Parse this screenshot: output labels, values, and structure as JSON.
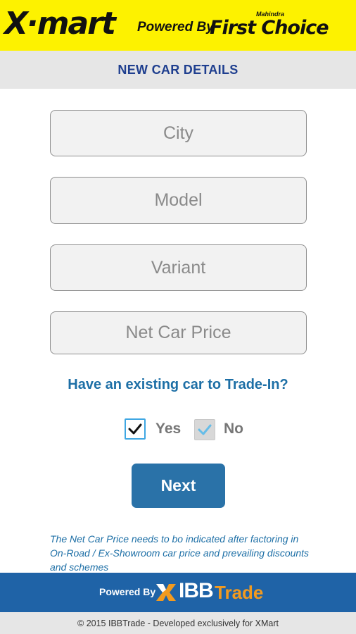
{
  "header": {
    "brand": "X·mart",
    "powered_by": "Powered By",
    "partner_small": "Mahindra",
    "partner": "First Choice",
    "background_color": "#fdf200"
  },
  "page_title": "NEW CAR DETAILS",
  "form": {
    "city_placeholder": "City",
    "model_placeholder": "Model",
    "variant_placeholder": "Variant",
    "price_placeholder": "Net Car Price"
  },
  "trade_in": {
    "question": "Have an existing car to Trade-In?",
    "yes_label": "Yes",
    "no_label": "No",
    "yes_checked": true,
    "no_checked": true
  },
  "next_label": "Next",
  "note": "The Net Car Price needs to bo indicated after factoring in On-Road / Ex-Showroom car price and prevailing discounts and schemes",
  "footer": {
    "powered_by": "Powered By",
    "brand_main": "IBB",
    "brand_secondary": "Trade",
    "copyright": "© 2015 IBBTrade - Developed exclusively for XMart",
    "bar_color": "#1f63a7",
    "accent_color": "#f29a1f"
  }
}
